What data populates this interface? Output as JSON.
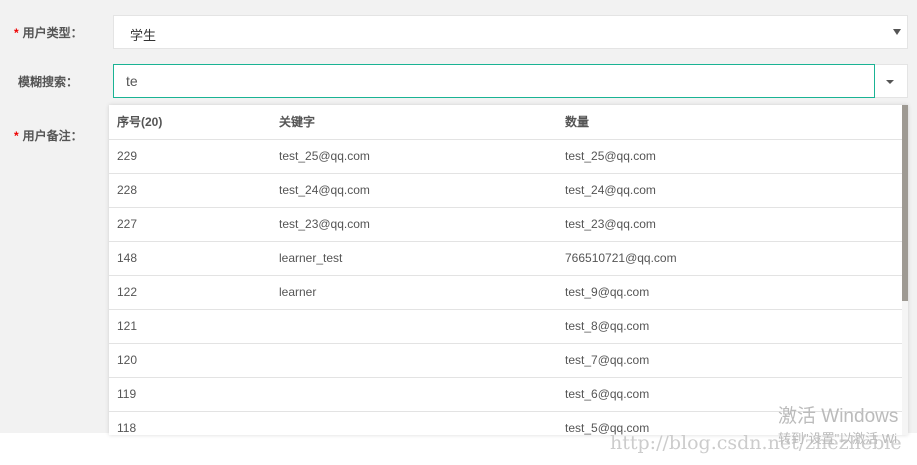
{
  "form": {
    "user_type_label": "用户类型：",
    "user_type_value": "学生",
    "fuzzy_search_label": "模糊搜索：",
    "fuzzy_search_value": "te",
    "user_note_label": "用户备注：",
    "required_mark": "*"
  },
  "dropdown": {
    "headers": [
      "序号(20)",
      "关键字",
      "数量"
    ],
    "rows": [
      [
        "229",
        "test_25@qq.com",
        "test_25@qq.com"
      ],
      [
        "228",
        "test_24@qq.com",
        "test_24@qq.com"
      ],
      [
        "227",
        "test_23@qq.com",
        "test_23@qq.com"
      ],
      [
        "148",
        "learner_test",
        "766510721@qq.com"
      ],
      [
        "122",
        "learner",
        "test_9@qq.com"
      ],
      [
        "121",
        "",
        "test_8@qq.com"
      ],
      [
        "120",
        "",
        "test_7@qq.com"
      ],
      [
        "119",
        "",
        "test_6@qq.com"
      ],
      [
        "118",
        "",
        "test_5@qq.com"
      ]
    ]
  },
  "watermark": {
    "activate_title": "激活 Windows",
    "activate_sub": "转到\"设置\"以激活 Wi",
    "blog_url": "http://blog.csdn.net/zhezhebie"
  }
}
